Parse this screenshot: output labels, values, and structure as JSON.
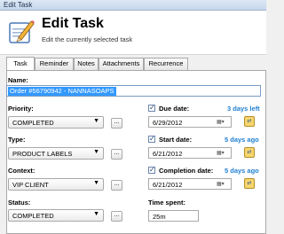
{
  "window": {
    "title": "Edit Task"
  },
  "header": {
    "title": "Edit Task",
    "subtitle": "Edit the currently selected task",
    "icon": "pencil-icon"
  },
  "tabs": [
    {
      "label": "Task",
      "active": true
    },
    {
      "label": "Reminder",
      "active": false
    },
    {
      "label": "Notes",
      "active": false
    },
    {
      "label": "Attachments",
      "active": false
    },
    {
      "label": "Recurrence",
      "active": false
    }
  ],
  "form": {
    "name_label": "Name:",
    "name_value": "Order #56790942 - NANNASOAPS",
    "priority": {
      "label": "Priority:",
      "value": "COMPLETED"
    },
    "type": {
      "label": "Type:",
      "value": "PRODUCT LABELS"
    },
    "context": {
      "label": "Context:",
      "value": "VIP CLIENT"
    },
    "status": {
      "label": "Status:",
      "value": "COMPLETED"
    },
    "due_date": {
      "label": "Due date:",
      "value": "6/29/2012",
      "relative": "3 days left",
      "checked": true
    },
    "start_date": {
      "label": "Start date:",
      "value": "6/21/2012",
      "relative": "5 days ago",
      "checked": true
    },
    "completion_date": {
      "label": "Completion date:",
      "value": "6/21/2012",
      "relative": "5 days ago",
      "checked": true
    },
    "time_spent": {
      "label": "Time spent:",
      "value": "25m"
    },
    "browse_label": "...",
    "check_glyph": "✓",
    "dropdown_glyph": "▼",
    "calendar_glyph": "▦▾",
    "picker_glyph": "⇄"
  },
  "colors": {
    "accent": "#1e7fd1",
    "selection": "#3399ff",
    "title_bar": "#c5d7ec"
  }
}
